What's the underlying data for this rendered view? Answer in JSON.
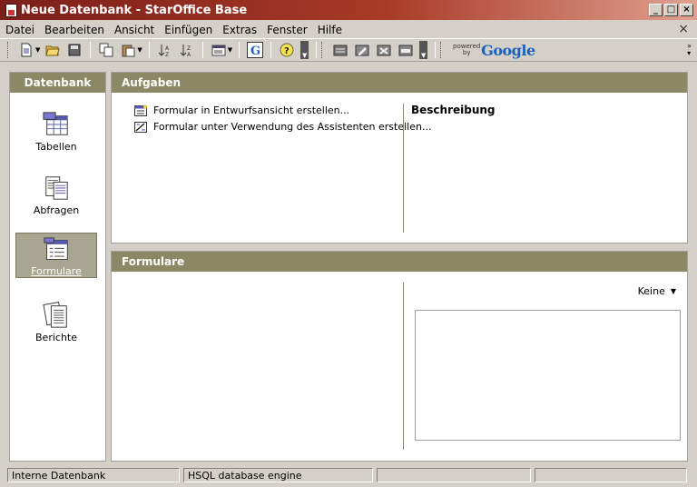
{
  "window": {
    "title": "Neue Datenbank - StarOffice Base",
    "buttons": [
      "_",
      "□",
      "×"
    ]
  },
  "menubar": {
    "items": [
      "Datei",
      "Bearbeiten",
      "Ansicht",
      "Einfügen",
      "Extras",
      "Fenster",
      "Hilfe"
    ],
    "close": "×"
  },
  "toolbar": {
    "google_powered": "powered by",
    "google_word": "Google"
  },
  "sidebar": {
    "header": "Datenbank",
    "items": [
      {
        "label": "Tabellen",
        "icon": "tables-icon"
      },
      {
        "label": "Abfragen",
        "icon": "queries-icon"
      },
      {
        "label": "Formulare",
        "icon": "forms-icon",
        "selected": true
      },
      {
        "label": "Berichte",
        "icon": "reports-icon"
      }
    ]
  },
  "tasks": {
    "header": "Aufgaben",
    "items": [
      {
        "label": "Formular in Entwurfsansicht erstellen...",
        "icon": "form-design-icon"
      },
      {
        "label": "Formular unter Verwendung des Assistenten erstellen...",
        "icon": "form-wizard-icon"
      }
    ],
    "description_header": "Beschreibung"
  },
  "forms": {
    "header": "Formulare",
    "preview_select": "Keine"
  },
  "statusbar": {
    "cells": [
      "Interne Datenbank",
      "HSQL database engine",
      "",
      ""
    ]
  },
  "colors": {
    "panel_header": "#8b8865",
    "selected_item": "#a8a690",
    "title_gradient_start": "#7b1f1a"
  }
}
